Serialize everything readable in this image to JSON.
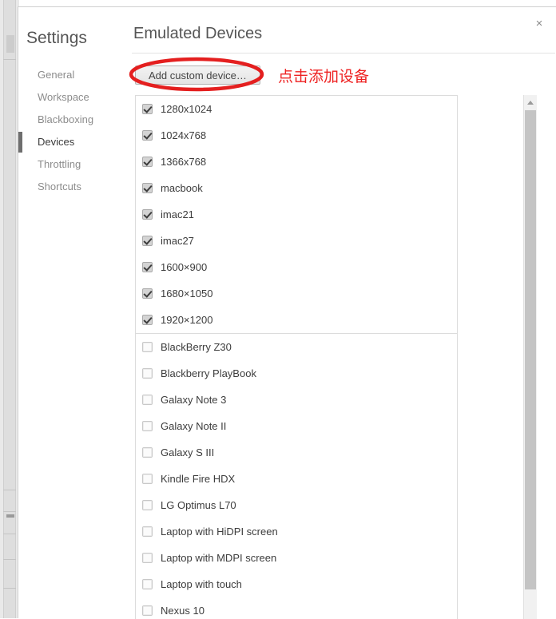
{
  "window": {
    "close_label": "×"
  },
  "sidebar": {
    "title": "Settings",
    "items": [
      {
        "label": "General",
        "active": false
      },
      {
        "label": "Workspace",
        "active": false
      },
      {
        "label": "Blackboxing",
        "active": false
      },
      {
        "label": "Devices",
        "active": true
      },
      {
        "label": "Throttling",
        "active": false
      },
      {
        "label": "Shortcuts",
        "active": false
      }
    ]
  },
  "main": {
    "panel_title": "Emulated Devices",
    "add_device_label": "Add custom device…",
    "annotation": "点击添加设备",
    "annotation_color": "#ee2222"
  },
  "device_list": {
    "groups": [
      {
        "name": "checked-devices",
        "items": [
          {
            "label": "1280x1024",
            "checked": true
          },
          {
            "label": "1024x768",
            "checked": true
          },
          {
            "label": "1366x768",
            "checked": true
          },
          {
            "label": "macbook",
            "checked": true
          },
          {
            "label": "imac21",
            "checked": true
          },
          {
            "label": "imac27",
            "checked": true
          },
          {
            "label": "1600×900",
            "checked": true
          },
          {
            "label": "1680×1050",
            "checked": true
          },
          {
            "label": "1920×1200",
            "checked": true
          }
        ]
      },
      {
        "name": "unchecked-devices",
        "items": [
          {
            "label": "BlackBerry Z30",
            "checked": false
          },
          {
            "label": "Blackberry PlayBook",
            "checked": false
          },
          {
            "label": "Galaxy Note 3",
            "checked": false
          },
          {
            "label": "Galaxy Note II",
            "checked": false
          },
          {
            "label": "Galaxy S III",
            "checked": false
          },
          {
            "label": "Kindle Fire HDX",
            "checked": false
          },
          {
            "label": "LG Optimus L70",
            "checked": false
          },
          {
            "label": "Laptop with HiDPI screen",
            "checked": false
          },
          {
            "label": "Laptop with MDPI screen",
            "checked": false
          },
          {
            "label": "Laptop with touch",
            "checked": false
          },
          {
            "label": "Nexus 10",
            "checked": false
          }
        ]
      }
    ]
  },
  "scrollbar": {
    "up_arrow": "scroll-up-arrow"
  }
}
